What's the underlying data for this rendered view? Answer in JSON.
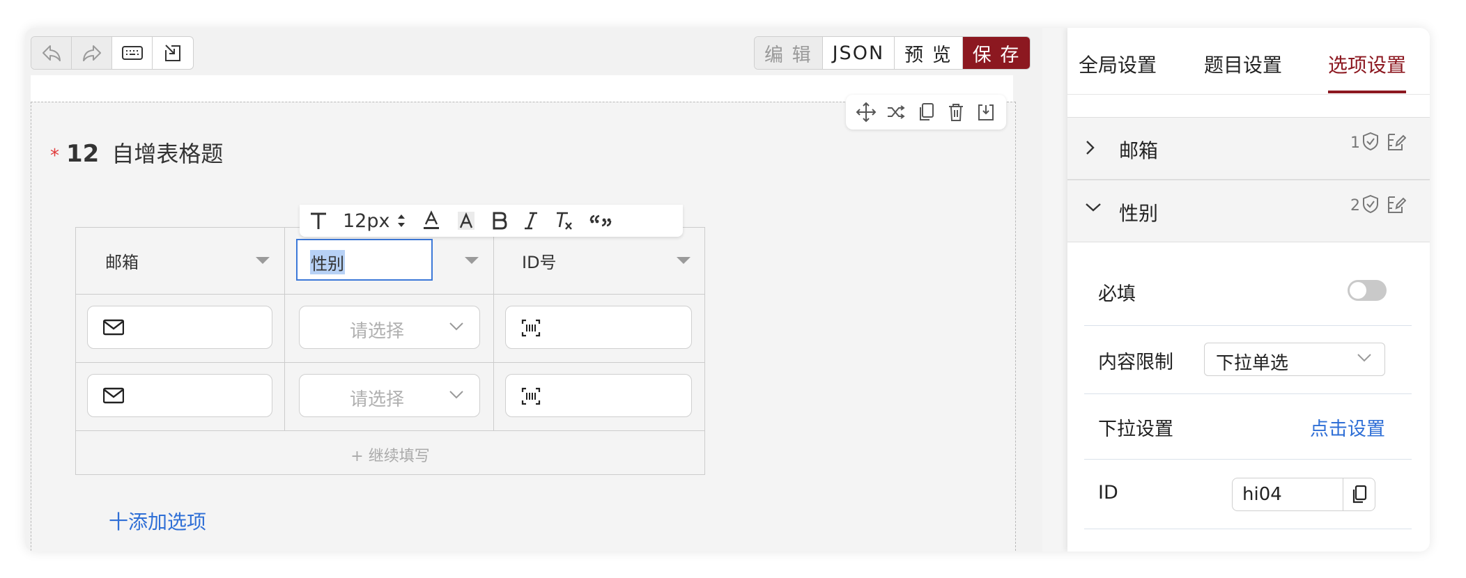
{
  "toolbar": {
    "history_buttons": [
      "undo-icon",
      "redo-icon",
      "keyboard-icon",
      "import-icon"
    ],
    "modes": {
      "edit": "编 辑",
      "json": "JSON",
      "preview": "预 览",
      "save": "保 存"
    }
  },
  "question": {
    "required_mark": "*",
    "number": "12",
    "title": "自增表格题",
    "tool_icons": [
      "move-icon",
      "shuffle-icon",
      "copy-icon",
      "delete-icon",
      "save-to-bank-icon"
    ]
  },
  "format_toolbar": {
    "font_size": "12px",
    "buttons": [
      "text-icon",
      "font-size-stepper-icon",
      "font-color-icon",
      "highlight-icon",
      "bold-icon",
      "italic-icon",
      "clear-format-icon",
      "quote-icon"
    ]
  },
  "table": {
    "headers": [
      "邮箱",
      "性别",
      "ID号"
    ],
    "rows": [
      {
        "email_icon": "mail-icon",
        "select_placeholder": "请选择",
        "id_icon": "barcode-icon"
      },
      {
        "email_icon": "mail-icon",
        "select_placeholder": "请选择",
        "id_icon": "barcode-icon"
      }
    ],
    "continue_label": "+ 继续填写"
  },
  "add_option_label": "十添加选项",
  "sidebar": {
    "tabs": [
      "全局设置",
      "题目设置",
      "选项设置"
    ],
    "active_tab": "选项设置",
    "accent_color": "#8c1820",
    "options": [
      {
        "name": "邮箱",
        "count": "1",
        "expanded": false
      },
      {
        "name": "性别",
        "count": "2",
        "expanded": true
      }
    ],
    "props": {
      "required_label": "必填",
      "required_on": false,
      "content_limit_label": "内容限制",
      "content_limit_value": "下拉单选",
      "dropdown_label": "下拉设置",
      "dropdown_link": "点击设置",
      "id_label": "ID",
      "id_value": "hi04"
    }
  }
}
